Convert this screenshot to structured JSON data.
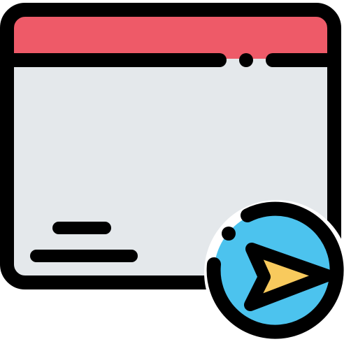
{
  "icon": {
    "name": "browser-window-send-icon",
    "parts": [
      "window-frame",
      "title-bar",
      "content-area",
      "text-line-short",
      "text-line-long",
      "send-badge",
      "paper-plane-icon"
    ]
  },
  "colors": {
    "outline": "#000000",
    "title_bar": "#ee5a68",
    "content_area": "#e4e8eb",
    "badge": "#4cc3ee",
    "plane": "#f8ca5d"
  }
}
